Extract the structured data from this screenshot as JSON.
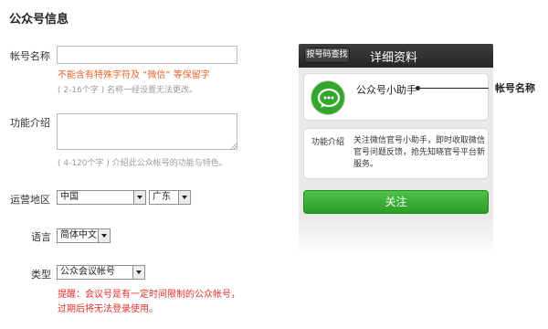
{
  "page": {
    "title": "公众号信息"
  },
  "form": {
    "account_name": {
      "label": "帐号名称",
      "value": "",
      "error": "不能含有特殊字符及 “微信” 等保留字",
      "hint": "( 2-16个字 ) 名称一经设置无法更改。"
    },
    "description": {
      "label": "功能介绍",
      "value": "",
      "hint": "( 4-120个字 ) 介绍此公众帐号的功能与特色。"
    },
    "region": {
      "label": "运营地区",
      "country": "中国",
      "province": "广东"
    },
    "language": {
      "label": "语言",
      "value": "简体中文"
    },
    "type": {
      "label": "类型",
      "value": "公众会议帐号",
      "warning_line1": "提醒：会议号是有一定时间限制的公众帐号，",
      "warning_line2": "过期后将无法登录使用。"
    }
  },
  "preview": {
    "back_label": "按号码查找",
    "topbar_title": "详细资料",
    "account_name": "公众号小助手",
    "function_label": "功能介绍",
    "function_text": "关注微信官号小助手，即时收取微信官号问题反馈，抢先知晓官号平台新服务。",
    "follow_label": "关注",
    "callout": "帐号名称",
    "accent_color": "#2fa82b"
  }
}
